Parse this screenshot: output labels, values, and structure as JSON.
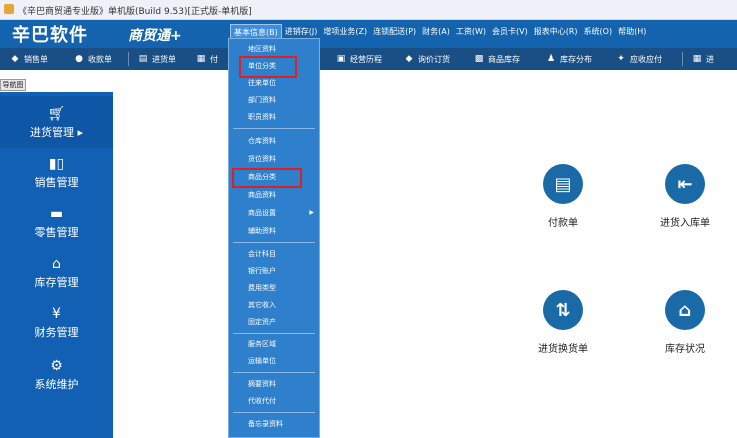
{
  "window": {
    "title": "《辛巴商贸通专业版》单机版(Build 9.53)[正式版-单机版]"
  },
  "brand": {
    "main": "辛巴软件",
    "sub": "商贸通+"
  },
  "menu": [
    "基本信息(B)",
    "进销存(J)",
    "增项业务(Z)",
    "连锁配送(P)",
    "财务(A)",
    "工资(W)",
    "会员卡(V)",
    "报表中心(R)",
    "系统(O)",
    "帮助(H)"
  ],
  "toolbar": {
    "sales": "销售单",
    "receipt": "收款单",
    "purchase": "进货单",
    "pay": "付",
    "history": "经营历程",
    "inquiry": "询价订货",
    "stock": "商品库存",
    "distribution": "库存分布",
    "ar_ap": "应收应付",
    "more": "进"
  },
  "nav_tab": "导航图",
  "sidebar": {
    "purchase": "进货管理 ▸",
    "sales": "销售管理",
    "retail": "零售管理",
    "inventory": "库存管理",
    "finance": "财务管理",
    "system": "系统维护"
  },
  "dropdown": {
    "region": "地区资料",
    "unit_category": "单位分类",
    "partner": "往来单位",
    "department": "部门资料",
    "staff": "职员资料",
    "warehouse": "仓库资料",
    "location": "货位资料",
    "product_category": "商品分类",
    "product": "商品资料",
    "product_settings": "商品设置",
    "aux": "辅助资料",
    "account": "会计科目",
    "bank": "银行账户",
    "expense": "费用类型",
    "other_income": "其它收入",
    "assets": "固定资产",
    "service_area": "服务区域",
    "shipping": "运输单位",
    "summary": "摘要资料",
    "collect": "代收代付",
    "memo": "备忘录资料"
  },
  "tiles": {
    "payment": "付款单",
    "stock_in": "进货入库单",
    "exchange": "进货换货单",
    "stock_status": "库存状况"
  },
  "icons": {
    "cart": "cart-icon",
    "bar_chart": "bar-chart-icon",
    "register": "register-icon",
    "warehouse": "warehouse-icon",
    "finance": "finance-icon",
    "gear": "gear-icon"
  },
  "colors": {
    "sidebar": "#1160b3",
    "toolbar": "#1a4f86",
    "brand": "#1463ae",
    "dropdown": "#2e7fcc",
    "highlight": "#e02020",
    "tile": "#1a6aa8"
  }
}
